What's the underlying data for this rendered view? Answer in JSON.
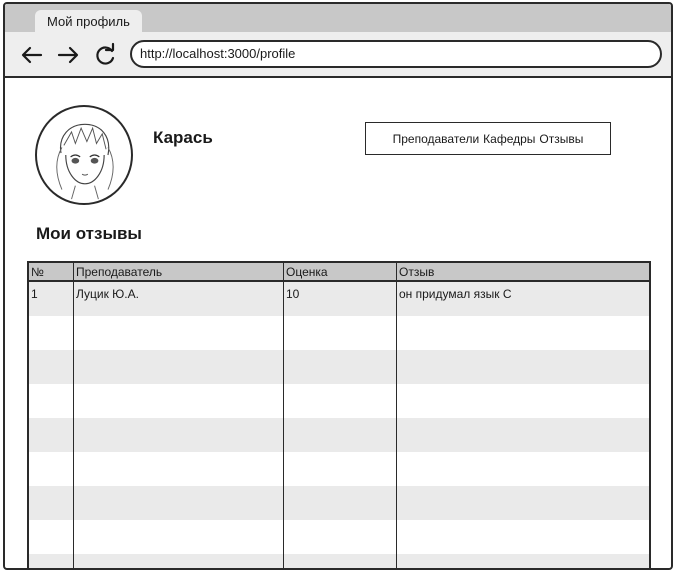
{
  "browser": {
    "tab_title": "Мой профиль",
    "url": "http://localhost:3000/profile",
    "back_icon": "arrow-left-icon",
    "forward_icon": "arrow-right-icon",
    "reload_icon": "reload-icon"
  },
  "profile": {
    "name": "Карась",
    "avatar_icon": "anime-avatar"
  },
  "nav": {
    "teachers": "Преподаватели",
    "departments": "Кафедры",
    "reviews": "Отзывы"
  },
  "reviews": {
    "title": "Мои отзывы",
    "columns": {
      "num": "№",
      "teacher": "Преподаватель",
      "grade": "Оценка",
      "review": "Отзыв"
    },
    "rows": [
      {
        "num": "1",
        "teacher": "Луцик Ю.А.",
        "grade": "10",
        "review": "он придумал язык С"
      },
      {
        "num": "",
        "teacher": "",
        "grade": "",
        "review": ""
      },
      {
        "num": "",
        "teacher": "",
        "grade": "",
        "review": ""
      },
      {
        "num": "",
        "teacher": "",
        "grade": "",
        "review": ""
      },
      {
        "num": "",
        "teacher": "",
        "grade": "",
        "review": ""
      },
      {
        "num": "",
        "teacher": "",
        "grade": "",
        "review": ""
      },
      {
        "num": "",
        "teacher": "",
        "grade": "",
        "review": ""
      },
      {
        "num": "",
        "teacher": "",
        "grade": "",
        "review": ""
      },
      {
        "num": "",
        "teacher": "",
        "grade": "",
        "review": ""
      }
    ]
  },
  "colors": {
    "chrome": "#c8c8c8",
    "toolbar": "#eeeeee",
    "stripe": "#eaeaea",
    "stroke": "#2a2a2a"
  }
}
